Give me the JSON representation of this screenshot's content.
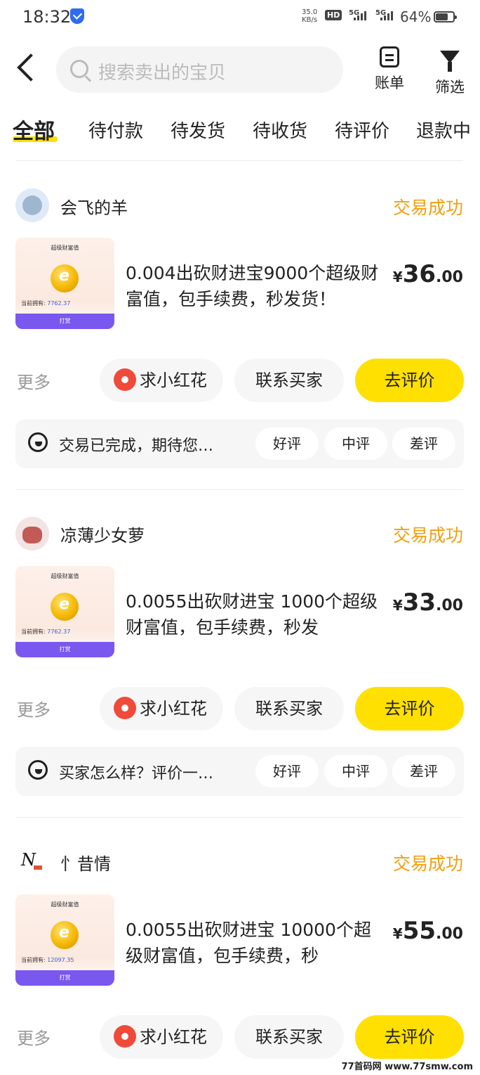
{
  "status_bar": {
    "time": "18:32",
    "net_speed_value": "35.0",
    "net_speed_unit": "KB/s",
    "hd": "HD",
    "sim1": "5G",
    "sim2": "5G",
    "battery": "64%"
  },
  "header": {
    "search_placeholder": "搜索卖出的宝贝",
    "bill_label": "账单",
    "filter_label": "筛选"
  },
  "tabs": [
    "全部",
    "待付款",
    "待发货",
    "待收货",
    "待评价",
    "退款中"
  ],
  "orders": [
    {
      "seller": "会飞的羊",
      "status": "交易成功",
      "thumb_title": "超级财富值",
      "thumb_own_label": "当前拥有:",
      "thumb_own_value": "7762.37",
      "thumb_bar": "打赏",
      "title": "0.004出砍财进宝9000个超级财富值，包手续费，秒发货！",
      "price_currency": "¥",
      "price_int": "36",
      "price_dec": ".00",
      "more": "更多",
      "btn_flower": "求小红花",
      "btn_contact": "联系买家",
      "btn_review": "去评价",
      "review_text": "交易已完成，期待您…",
      "good": "好评",
      "neutral": "中评",
      "bad": "差评"
    },
    {
      "seller": "凉薄少女萝",
      "status": "交易成功",
      "thumb_title": "超级财富值",
      "thumb_own_label": "当前拥有:",
      "thumb_own_value": "7762.37",
      "thumb_bar": "打赏",
      "title": "0.0055出砍财进宝 1000个超级财富值，包手续费，秒发",
      "price_currency": "¥",
      "price_int": "33",
      "price_dec": ".00",
      "more": "更多",
      "btn_flower": "求小红花",
      "btn_contact": "联系买家",
      "btn_review": "去评价",
      "review_text": "买家怎么样？评价一…",
      "good": "好评",
      "neutral": "中评",
      "bad": "差评"
    },
    {
      "seller": "忄昔情",
      "status": "交易成功",
      "thumb_title": "超级财富值",
      "thumb_own_label": "当前拥有:",
      "thumb_own_value": "12097.35",
      "thumb_bar": "打赏",
      "title": "0.0055出砍财进宝 10000个超级财富值，包手续费，秒",
      "price_currency": "¥",
      "price_int": "55",
      "price_dec": ".00",
      "more": "更多",
      "btn_flower": "求小红花",
      "btn_contact": "联系买家",
      "btn_review": "去评价"
    }
  ],
  "watermark": "77首码网 www.77smw.com"
}
